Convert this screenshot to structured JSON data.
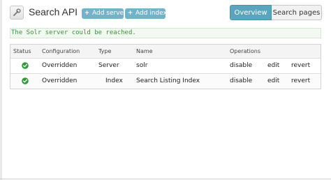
{
  "header": {
    "title": "Search API",
    "icon": "wrench-icon",
    "actions": [
      {
        "label": "Add server",
        "icon": "plus-icon"
      },
      {
        "label": "Add index",
        "icon": "plus-icon"
      }
    ],
    "tabs": [
      {
        "label": "Overview",
        "active": true
      },
      {
        "label": "Search pages",
        "active": false
      }
    ]
  },
  "message": {
    "text": "The Solr server could be reached."
  },
  "table": {
    "columns": [
      "Status",
      "Configuration",
      "Type",
      "Name",
      "Operations"
    ],
    "rows": [
      {
        "status_icon": "check-circle-icon",
        "configuration": "Overridden",
        "type": "Server",
        "name": "solr",
        "operations": [
          "disable",
          "edit",
          "revert"
        ]
      },
      {
        "status_icon": "check-circle-icon",
        "configuration": "Overridden",
        "type": "Index",
        "name": "Search Listing Index",
        "operations": [
          "disable",
          "edit",
          "revert"
        ]
      }
    ]
  },
  "colors": {
    "accent": "#5aa4bd",
    "button": "#72b3c9",
    "link": "#1b80a8",
    "success_text": "#3f8f3f",
    "success_icon": "#2e9a3a"
  }
}
